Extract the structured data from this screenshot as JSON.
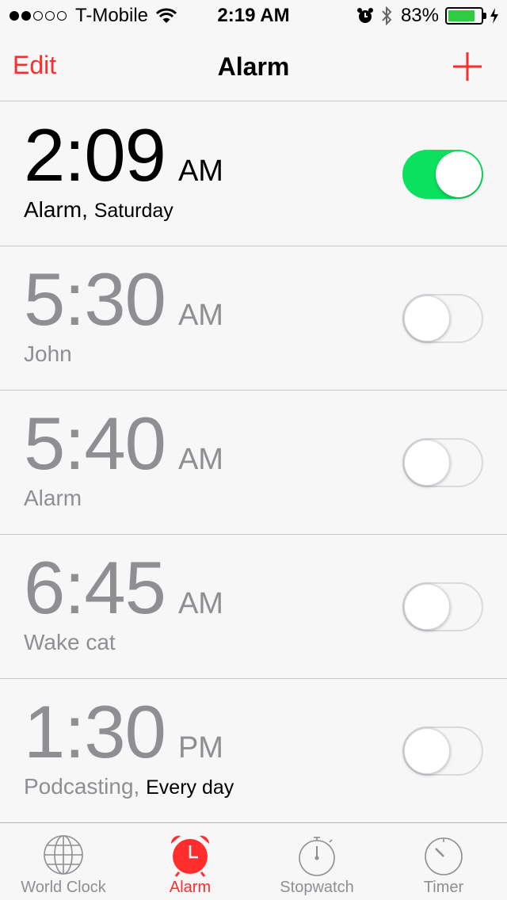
{
  "status_bar": {
    "carrier": "T-Mobile",
    "time": "2:19 AM",
    "battery_percent": "83%",
    "battery_level": 0.83
  },
  "nav": {
    "edit_label": "Edit",
    "title": "Alarm",
    "add_icon": "plus-icon"
  },
  "alarms": [
    {
      "time": "2:09",
      "ampm": "AM",
      "label": "Alarm,",
      "repeat": "Saturday",
      "enabled": true
    },
    {
      "time": "5:30",
      "ampm": "AM",
      "label": "John",
      "repeat": "",
      "enabled": false
    },
    {
      "time": "5:40",
      "ampm": "AM",
      "label": "Alarm",
      "repeat": "",
      "enabled": false
    },
    {
      "time": "6:45",
      "ampm": "AM",
      "label": "Wake cat",
      "repeat": "",
      "enabled": false
    },
    {
      "time": "1:30",
      "ampm": "PM",
      "label": "Podcasting,",
      "repeat": "Every day",
      "enabled": false
    }
  ],
  "tabs": [
    {
      "label": "World Clock",
      "icon": "globe-icon",
      "active": false
    },
    {
      "label": "Alarm",
      "icon": "alarm-clock-icon",
      "active": true
    },
    {
      "label": "Stopwatch",
      "icon": "stopwatch-icon",
      "active": false
    },
    {
      "label": "Timer",
      "icon": "timer-icon",
      "active": false
    }
  ],
  "colors": {
    "accent": "#ff2d2d",
    "toggle_on": "#0be15d",
    "inactive_text": "#8e8e93"
  }
}
